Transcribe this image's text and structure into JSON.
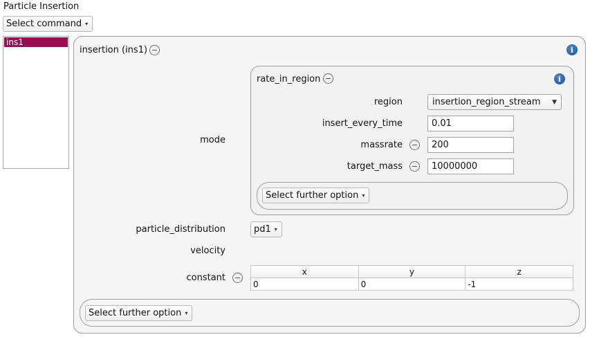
{
  "page_title": "Particle Insertion",
  "command_select": {
    "label": "Select command"
  },
  "list": {
    "items": [
      "ins1"
    ],
    "selected": "ins1"
  },
  "insertion_group": {
    "title": "insertion (ins1)",
    "mode_label": "mode",
    "mode_group": {
      "title": "rate_in_region",
      "region_label": "region",
      "region_value": "insertion_region_stream",
      "insert_every_time_label": "insert_every_time",
      "insert_every_time_value": "0.01",
      "massrate_label": "massrate",
      "massrate_value": "200",
      "target_mass_label": "target_mass",
      "target_mass_value": "10000000",
      "further_option_label": "Select further option"
    },
    "particle_distribution_label": "particle_distribution",
    "particle_distribution_value": "pd1",
    "velocity_label": "velocity",
    "constant_label": "constant",
    "vector": {
      "headers": [
        "x",
        "y",
        "z"
      ],
      "values": [
        "0",
        "0",
        "-1"
      ]
    },
    "further_option_label": "Select further option"
  },
  "icons": {
    "info": "info-icon",
    "collapse": "minus-circle-icon",
    "dropdown": "caret-down-icon"
  },
  "colors": {
    "selection": "#9b0d54",
    "info": "#1d4f94"
  }
}
